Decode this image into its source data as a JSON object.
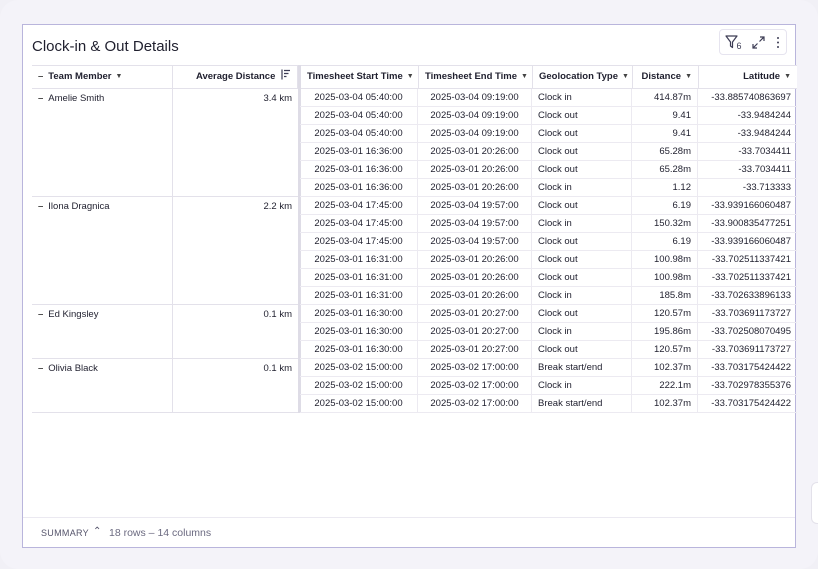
{
  "title": "Clock-in & Out Details",
  "toolbar": {
    "filter_icon": "filter-icon",
    "filter_count": "6",
    "expand_icon": "expand-icon",
    "more_icon": "more-vertical-icon"
  },
  "columns": {
    "team_member": "Team Member",
    "average_distance": "Average Distance",
    "start_time": "Timesheet Start Time",
    "end_time": "Timesheet End Time",
    "geo_type": "Geolocation Type",
    "distance": "Distance",
    "latitude": "Latitude"
  },
  "groups": [
    {
      "name": "Amelie Smith",
      "avg": "3.4 km",
      "rows": [
        [
          "2025-03-04 05:40:00",
          "2025-03-04 09:19:00",
          "Clock in",
          "414.87m",
          "-33.885740863697"
        ],
        [
          "2025-03-04 05:40:00",
          "2025-03-04 09:19:00",
          "Clock out",
          "9.41",
          "-33.9484244"
        ],
        [
          "2025-03-04 05:40:00",
          "2025-03-04 09:19:00",
          "Clock out",
          "9.41",
          "-33.9484244"
        ],
        [
          "2025-03-01 16:36:00",
          "2025-03-01 20:26:00",
          "Clock out",
          "65.28m",
          "-33.7034411"
        ],
        [
          "2025-03-01 16:36:00",
          "2025-03-01 20:26:00",
          "Clock out",
          "65.28m",
          "-33.7034411"
        ],
        [
          "2025-03-01 16:36:00",
          "2025-03-01 20:26:00",
          "Clock in",
          "1.12",
          "-33.713333"
        ]
      ]
    },
    {
      "name": "Ilona Dragnica",
      "avg": "2.2 km",
      "rows": [
        [
          "2025-03-04 17:45:00",
          "2025-03-04 19:57:00",
          "Clock out",
          "6.19",
          "-33.939166060487"
        ],
        [
          "2025-03-04 17:45:00",
          "2025-03-04 19:57:00",
          "Clock in",
          "150.32m",
          "-33.900835477251"
        ],
        [
          "2025-03-04 17:45:00",
          "2025-03-04 19:57:00",
          "Clock out",
          "6.19",
          "-33.939166060487"
        ],
        [
          "2025-03-01 16:31:00",
          "2025-03-01 20:26:00",
          "Clock out",
          "100.98m",
          "-33.702511337421"
        ],
        [
          "2025-03-01 16:31:00",
          "2025-03-01 20:26:00",
          "Clock out",
          "100.98m",
          "-33.702511337421"
        ],
        [
          "2025-03-01 16:31:00",
          "2025-03-01 20:26:00",
          "Clock in",
          "185.8m",
          "-33.702633896133"
        ]
      ]
    },
    {
      "name": "Ed Kingsley",
      "avg": "0.1 km",
      "rows": [
        [
          "2025-03-01 16:30:00",
          "2025-03-01 20:27:00",
          "Clock out",
          "120.57m",
          "-33.703691173727"
        ],
        [
          "2025-03-01 16:30:00",
          "2025-03-01 20:27:00",
          "Clock in",
          "195.86m",
          "-33.702508070495"
        ],
        [
          "2025-03-01 16:30:00",
          "2025-03-01 20:27:00",
          "Clock out",
          "120.57m",
          "-33.703691173727"
        ]
      ]
    },
    {
      "name": "Olivia Black",
      "avg": "0.1 km",
      "rows": [
        [
          "2025-03-02 15:00:00",
          "2025-03-02 17:00:00",
          "Break start/end",
          "102.37m",
          "-33.703175424422"
        ],
        [
          "2025-03-02 15:00:00",
          "2025-03-02 17:00:00",
          "Clock in",
          "222.1m",
          "-33.702978355376"
        ],
        [
          "2025-03-02 15:00:00",
          "2025-03-02 17:00:00",
          "Break start/end",
          "102.37m",
          "-33.703175424422"
        ]
      ]
    }
  ],
  "summary": {
    "label": "SUMMARY",
    "caret": "^",
    "count": "18 rows – 14 columns"
  }
}
